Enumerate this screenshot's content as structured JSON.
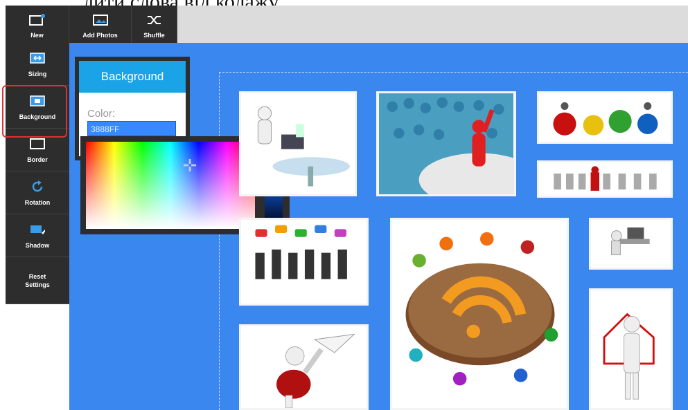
{
  "caption": "лити слова від колажу.",
  "toolbar": {
    "new_label": "New",
    "add_photos_label": "Add Photos",
    "shuffle_label": "Shuffle"
  },
  "sidebar": {
    "items": [
      {
        "label": "Sizing",
        "icon": "sizing-icon"
      },
      {
        "label": "Background",
        "icon": "background-icon"
      },
      {
        "label": "Border",
        "icon": "border-icon"
      },
      {
        "label": "Rotation",
        "icon": "rotation-icon"
      },
      {
        "label": "Shadow",
        "icon": "shadow-icon"
      },
      {
        "label": "Reset Settings",
        "icon": ""
      }
    ]
  },
  "background_panel": {
    "title": "Background",
    "color_label": "Color:",
    "color_value": "3888FF"
  },
  "colors": {
    "canvas_background": "#3A87F0",
    "panel_header": "#1AA3E6",
    "toolbar": "#2D2D2D",
    "highlight": "#E03030"
  }
}
